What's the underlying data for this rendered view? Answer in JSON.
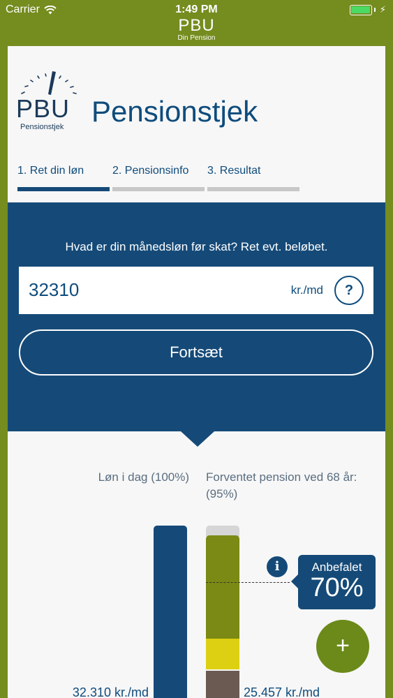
{
  "status_bar": {
    "carrier": "Carrier",
    "time": "1:49 PM"
  },
  "header": {
    "brand": "PBU",
    "brand_subtitle": "Din Pension"
  },
  "logo": {
    "name": "PBU",
    "subtitle": "Pensionstjek"
  },
  "page_title": "Pensionstjek",
  "steps": [
    {
      "label": "1. Ret din løn",
      "active": true
    },
    {
      "label": "2. Pensionsinfo",
      "active": false
    },
    {
      "label": "3. Resultat",
      "active": false
    }
  ],
  "salary_form": {
    "question": "Hvad er din månedsløn før skat? Ret evt. beløbet.",
    "value": "32310",
    "unit": "kr./md",
    "help_label": "?",
    "continue_label": "Fortsæt"
  },
  "comparison": {
    "today_label": "Løn i dag (100%)",
    "pension_label": "Forventet pension ved 68 år: (95%)",
    "today_amount": "32.310 kr./md",
    "pension_amount": "25.457 kr./md",
    "recommended_label": "Anbefalet",
    "recommended_pct": "70%",
    "info_label": "i",
    "fab_label": "+"
  },
  "colors": {
    "frame_green": "#758c1f",
    "navy": "#154a78",
    "bar_olive": "#7a8a14",
    "bar_yellow": "#ddd012",
    "bar_brown": "#6a5a52",
    "bar_grey": "#d6d6d6",
    "fab_green": "#6b8a1a"
  }
}
